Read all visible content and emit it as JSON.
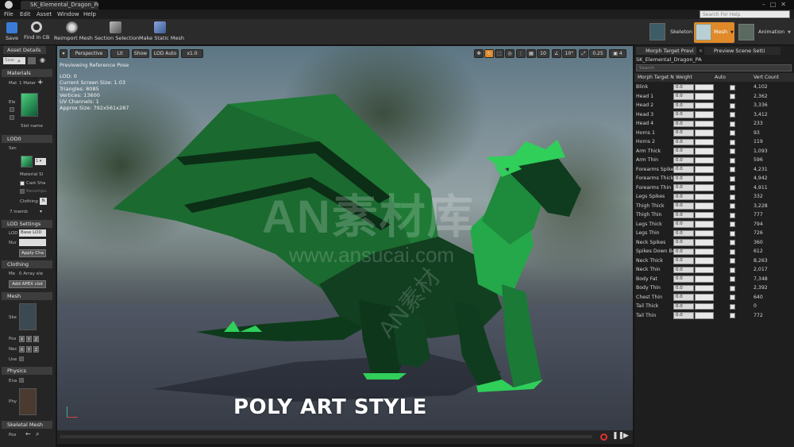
{
  "window": {
    "tab_title": "SK_Elemental_Dragon_PA"
  },
  "menu": [
    "File",
    "Edit",
    "Asset",
    "Window",
    "Help"
  ],
  "help_search": {
    "placeholder": "Search For Help"
  },
  "toolbar": {
    "save": "Save",
    "find_in_cb": "Find in CB",
    "reimport": "Reimport Mesh",
    "section_selection": "Section Selection",
    "make_static": "Make Static Mesh"
  },
  "modes": {
    "skeleton": "Skeleton",
    "mesh": "Mesh",
    "animation": "Animation"
  },
  "left": {
    "tab": "Asset Details",
    "search_placeholder": "Sear",
    "materials": "Materials",
    "mat_count": "1 Mater",
    "mat_abbr": "Mat",
    "ele": "Ele",
    "slot_name": "Slot name",
    "lod0": "LOD0",
    "sec": "Sec",
    "material_slot": "Material Sl",
    "cast_shadow": "Cast Sha",
    "recompute": "Recompu",
    "clothing": "Clothing",
    "clothing_val": "N",
    "seven": "7",
    "seven_txt": "7 memb",
    "lod_settings": "LOD Settings",
    "lod_label": "LOD",
    "lod_val": "Base LOD",
    "nu": "Nur",
    "apply": "Apply Cha",
    "clothing2": "Clothing",
    "me": "Me",
    "zero_array": "0 Array ele",
    "add_apex": "Add APEX clot",
    "mesh": "Mesh",
    "ske": "Ske",
    "pos": "Pos",
    "nec": "Nec",
    "use": "Use",
    "physics": "Physics",
    "ena": "Ena",
    "phy": "Phy",
    "skeletal_mesh": "Skeletal Mesh",
    "pos2": "Pos",
    "x": "X",
    "y": "Y",
    "z": "Z"
  },
  "viewport": {
    "perspective": "Perspective",
    "lit": "Lit",
    "show": "Show",
    "lod_auto": "LOD Auto",
    "speed": "x1.0",
    "grid_val": "10",
    "angle_val": "10°",
    "scale_val": "0.25",
    "cam_val": "4",
    "previewing": "Previewing Reference Pose",
    "info": [
      "LOD: 0",
      "Current Screen Size: 1.03",
      "Triangles: 8085",
      "Vertices: 13600",
      "UV Channels: 1",
      "Approx Size: 792x561x287"
    ],
    "caption": "POLY ART STYLE",
    "watermark": "AN素材库",
    "watermark_url": "www.ansucai.com",
    "watermark_diag": "AN素材"
  },
  "right": {
    "tab1": "Morph Target Previ",
    "tab2": "Preview Scene Setti",
    "asset": "SK_Elemental_Dragon_PA",
    "search_placeholder": "Search",
    "headers": {
      "name": "Morph Target N",
      "weight": "Weight",
      "auto": "Auto",
      "vert": "Vert Count"
    },
    "rows": [
      {
        "name": "Blink",
        "weight": "0.0",
        "vert": "4,102"
      },
      {
        "name": "Head 1",
        "weight": "0.0",
        "vert": "2,362"
      },
      {
        "name": "Head 2",
        "weight": "0.0",
        "vert": "3,336"
      },
      {
        "name": "Head 3",
        "weight": "0.0",
        "vert": "3,412"
      },
      {
        "name": "Head 4",
        "weight": "0.0",
        "vert": "233"
      },
      {
        "name": "Horns 1",
        "weight": "0.0",
        "vert": "93"
      },
      {
        "name": "Horns 2",
        "weight": "0.0",
        "vert": "119"
      },
      {
        "name": "Arm Thick",
        "weight": "0.0",
        "vert": "1,093"
      },
      {
        "name": "Arm Thin",
        "weight": "0.0",
        "vert": "596"
      },
      {
        "name": "Forearms Spikes",
        "weight": "0.0",
        "vert": "4,231"
      },
      {
        "name": "Forearms Thick",
        "weight": "0.0",
        "vert": "4,942"
      },
      {
        "name": "Forearms Thin",
        "weight": "0.0",
        "vert": "4,911"
      },
      {
        "name": "Legs Spikes",
        "weight": "0.0",
        "vert": "332"
      },
      {
        "name": "Thigh Thick",
        "weight": "0.0",
        "vert": "3,228"
      },
      {
        "name": "Thigh Thin",
        "weight": "0.0",
        "vert": "777"
      },
      {
        "name": "Legs Thick",
        "weight": "0.0",
        "vert": "794"
      },
      {
        "name": "Legs Thin",
        "weight": "0.0",
        "vert": "726"
      },
      {
        "name": "Neck Spikes",
        "weight": "0.0",
        "vert": "360"
      },
      {
        "name": "Spikes Down Bod",
        "weight": "0.0",
        "vert": "612"
      },
      {
        "name": "Neck Thick",
        "weight": "0.0",
        "vert": "8,263"
      },
      {
        "name": "Neck Thin",
        "weight": "0.0",
        "vert": "2,017"
      },
      {
        "name": "Body Fat",
        "weight": "0.0",
        "vert": "7,348"
      },
      {
        "name": "Body Thin",
        "weight": "0.0",
        "vert": "2,392"
      },
      {
        "name": "Chest Thin",
        "weight": "0.0",
        "vert": "640"
      },
      {
        "name": "Tail Thick",
        "weight": "0.0",
        "vert": "0"
      },
      {
        "name": "Tail Thin",
        "weight": "0.0",
        "vert": "772"
      }
    ]
  },
  "colors": {
    "accent_orange": "#e08a2a",
    "dragon_green": "#1f8a3d",
    "record_red": "#e03030"
  }
}
